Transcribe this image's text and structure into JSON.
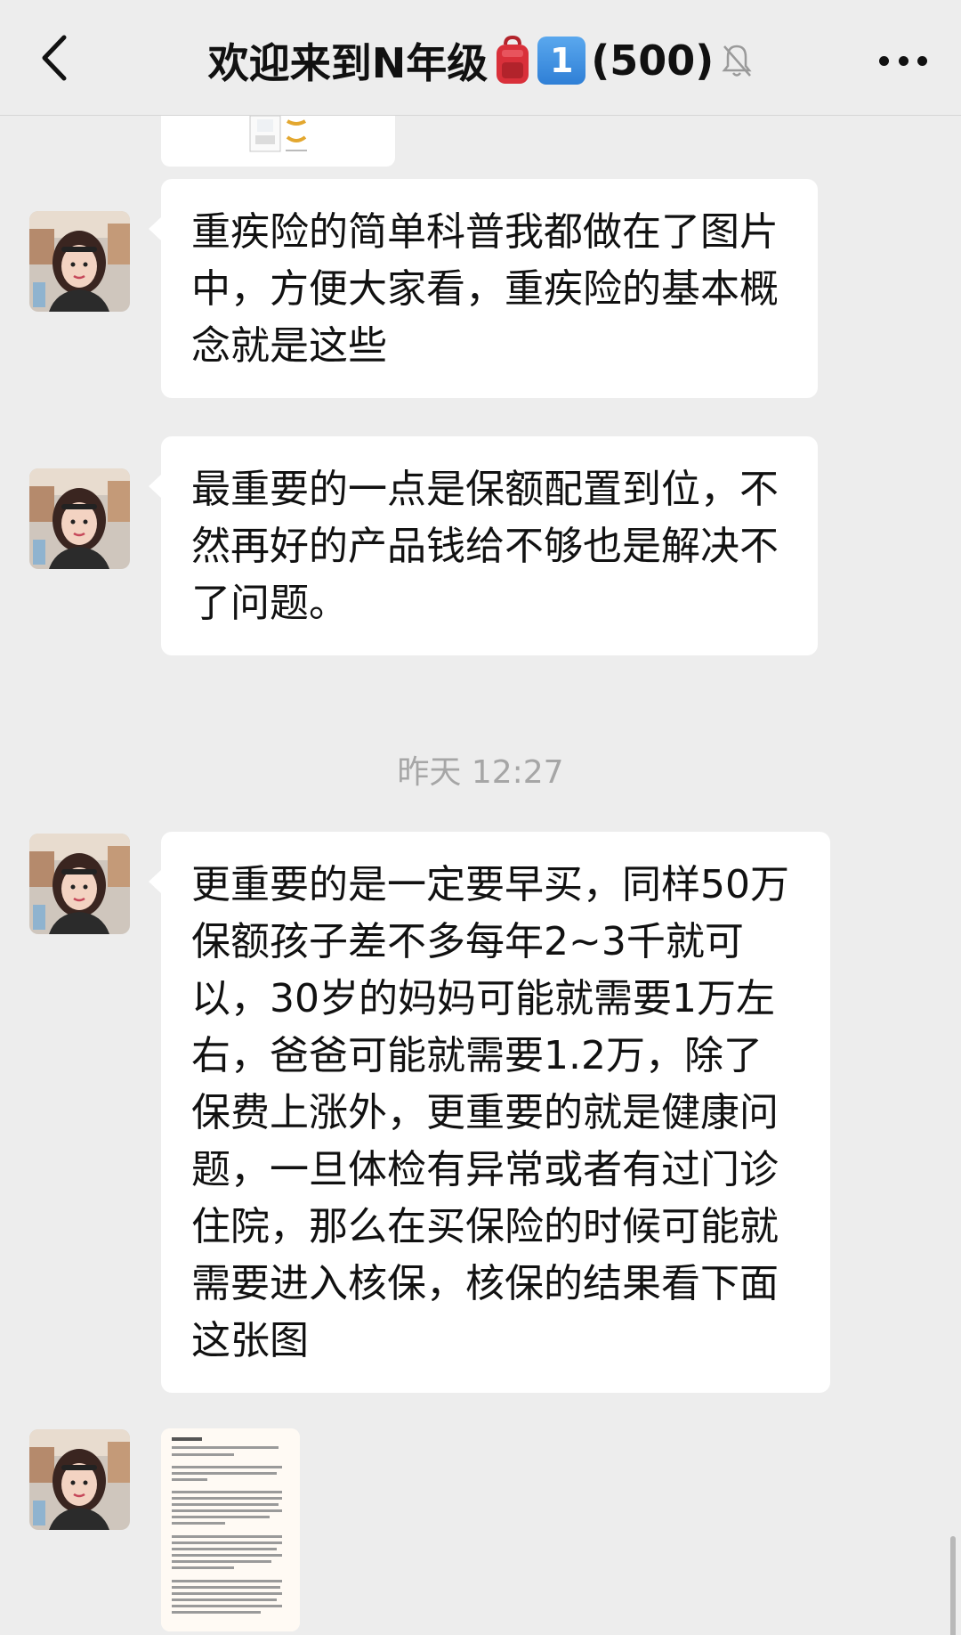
{
  "header": {
    "title": "欢迎来到N年级",
    "title_badge": "1",
    "member_count": "(500)",
    "back_icon": "chevron-left-icon",
    "more_icon": "more-dots-icon",
    "mute_icon": "bell-muted-icon"
  },
  "messages": [
    {
      "text": "重疾险的简单科普我都做在了图片中，方便大家看，重疾险的基本概念就是这些"
    },
    {
      "text": "最重要的一点是保额配置到位，不然再好的产品钱给不够也是解决不了问题。"
    },
    {
      "text": "更重要的是一定要早买，同样50万保额孩子差不多每年2~3千就可以，30岁的妈妈可能就需要1万左右，爸爸可能就需要1.2万，除了保费上涨外，更重要的就是健康问题，一旦体检有异常或者有过门诊住院，那么在买保险的时候可能就需要进入核保，核保的结果看下面这张图"
    }
  ],
  "timestamp": "昨天 12:27",
  "colors": {
    "background": "#ededed",
    "bubble": "#ffffff",
    "timestamp": "#a6a6a6"
  }
}
